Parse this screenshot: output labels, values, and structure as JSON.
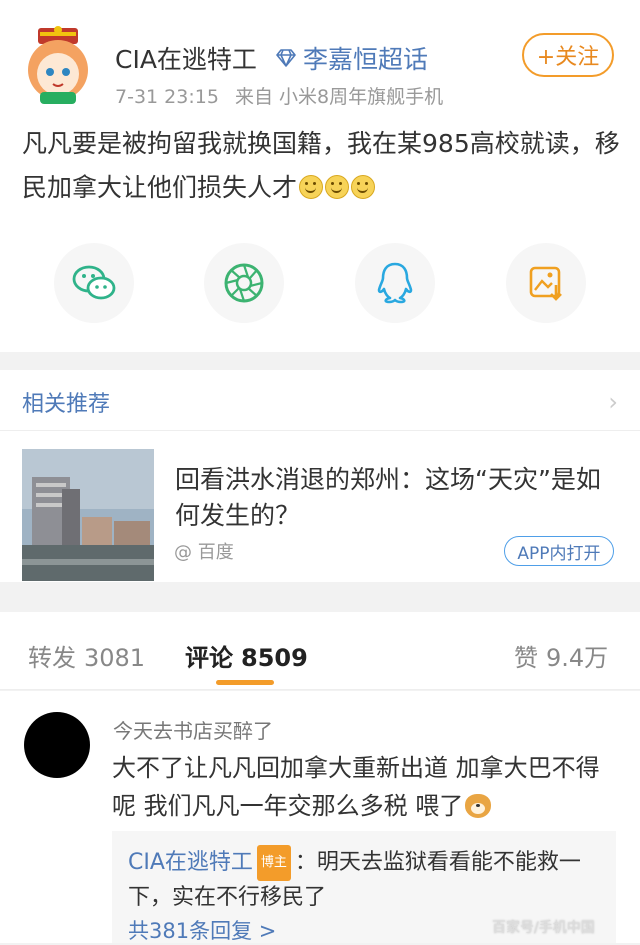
{
  "post": {
    "username": "CIA在逃特工",
    "topic": "李嘉恒超话",
    "follow_label": "+关注",
    "date": "7-31 23:15",
    "source": "来自 小米8周年旗舰手机",
    "content": "凡凡要是被拘留我就换国籍，我在某985高校就读，移民加拿大让他们损失人才",
    "share_targets": [
      "wechat-icon",
      "moments-icon",
      "qq-icon",
      "save-image-icon"
    ]
  },
  "related": {
    "heading": "相关推荐",
    "article_title": "回看洪水消退的郑州：这场“天灾”是如何发生的？",
    "article_source": "@ 百度",
    "open_in_app": "APP内打开"
  },
  "tabs": {
    "repost_label": "转发",
    "repost_count": "3081",
    "comment_label": "评论",
    "comment_count": "8509",
    "like_label": "赞",
    "like_count": "9.4万"
  },
  "comment": {
    "username": "今天去书店买醉了",
    "text": "大不了让凡凡回加拿大重新出道 加拿大巴不得呢 我们凡凡一年交那么多税 喂了",
    "reply": {
      "username": "CIA在逃特工",
      "badge": "博主",
      "text": "：明天去监狱看看能不能救一下，实在不行移民了",
      "count_label": "共381条回复 >"
    }
  },
  "watermark": "百家号/手机中国",
  "colors": {
    "accent_orange": "#f39c2a",
    "link_blue": "#4f7ab8"
  }
}
